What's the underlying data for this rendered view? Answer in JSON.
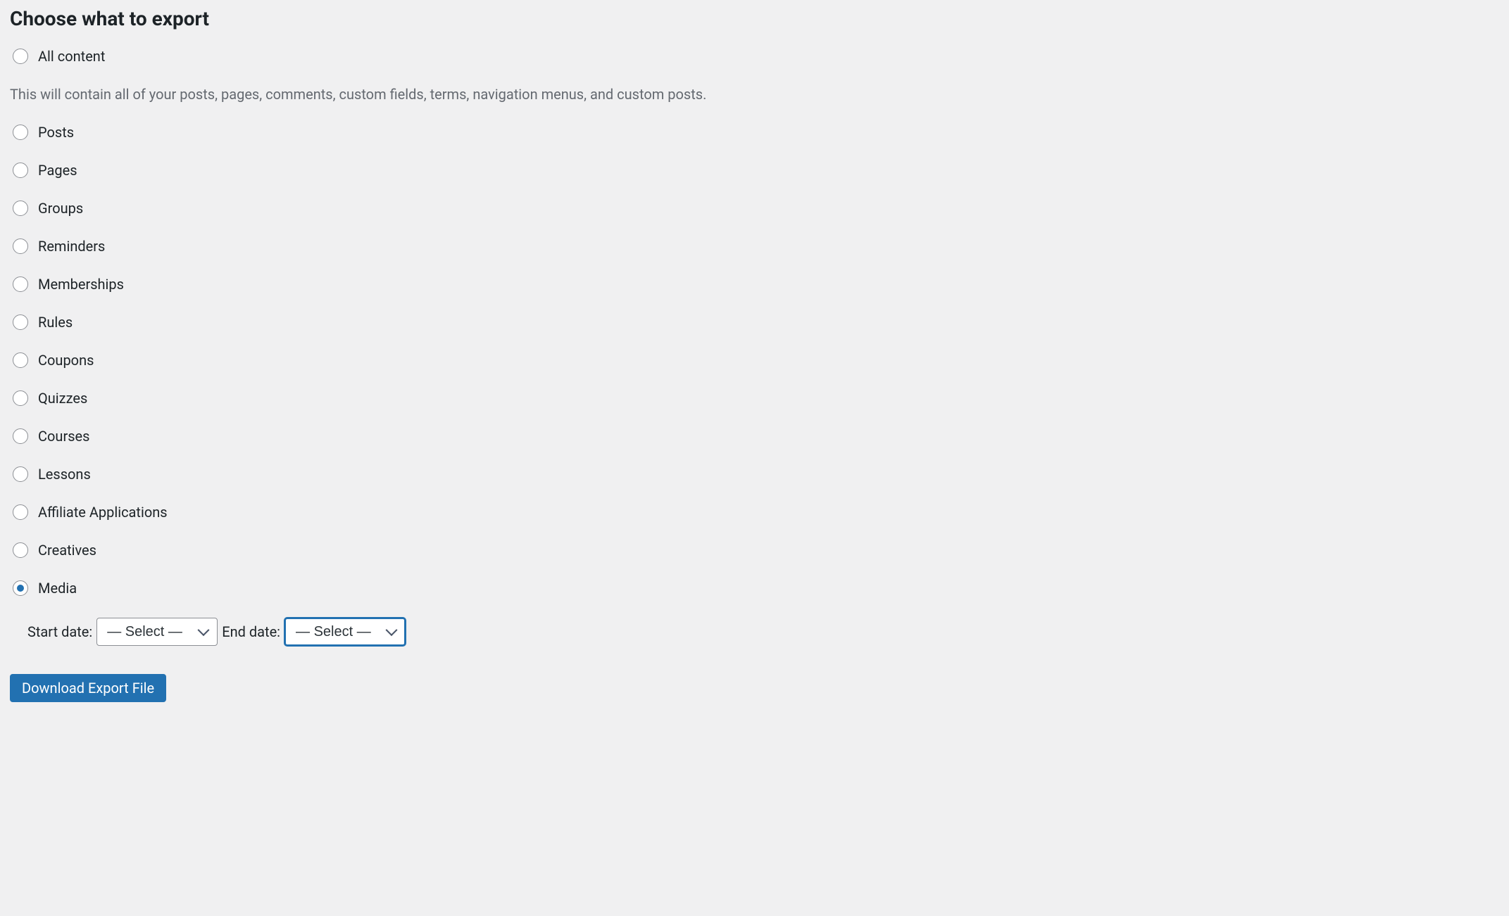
{
  "heading": "Choose what to export",
  "description": "This will contain all of your posts, pages, comments, custom fields, terms, navigation menus, and custom posts.",
  "options": {
    "all_content": "All content",
    "posts": "Posts",
    "pages": "Pages",
    "groups": "Groups",
    "reminders": "Reminders",
    "memberships": "Memberships",
    "rules": "Rules",
    "coupons": "Coupons",
    "quizzes": "Quizzes",
    "courses": "Courses",
    "lessons": "Lessons",
    "affiliate_applications": "Affiliate Applications",
    "creatives": "Creatives",
    "media": "Media"
  },
  "date_filter": {
    "start_label": "Start date:",
    "end_label": "End date:",
    "select_placeholder": "— Select —"
  },
  "button": {
    "download_label": "Download Export File"
  }
}
